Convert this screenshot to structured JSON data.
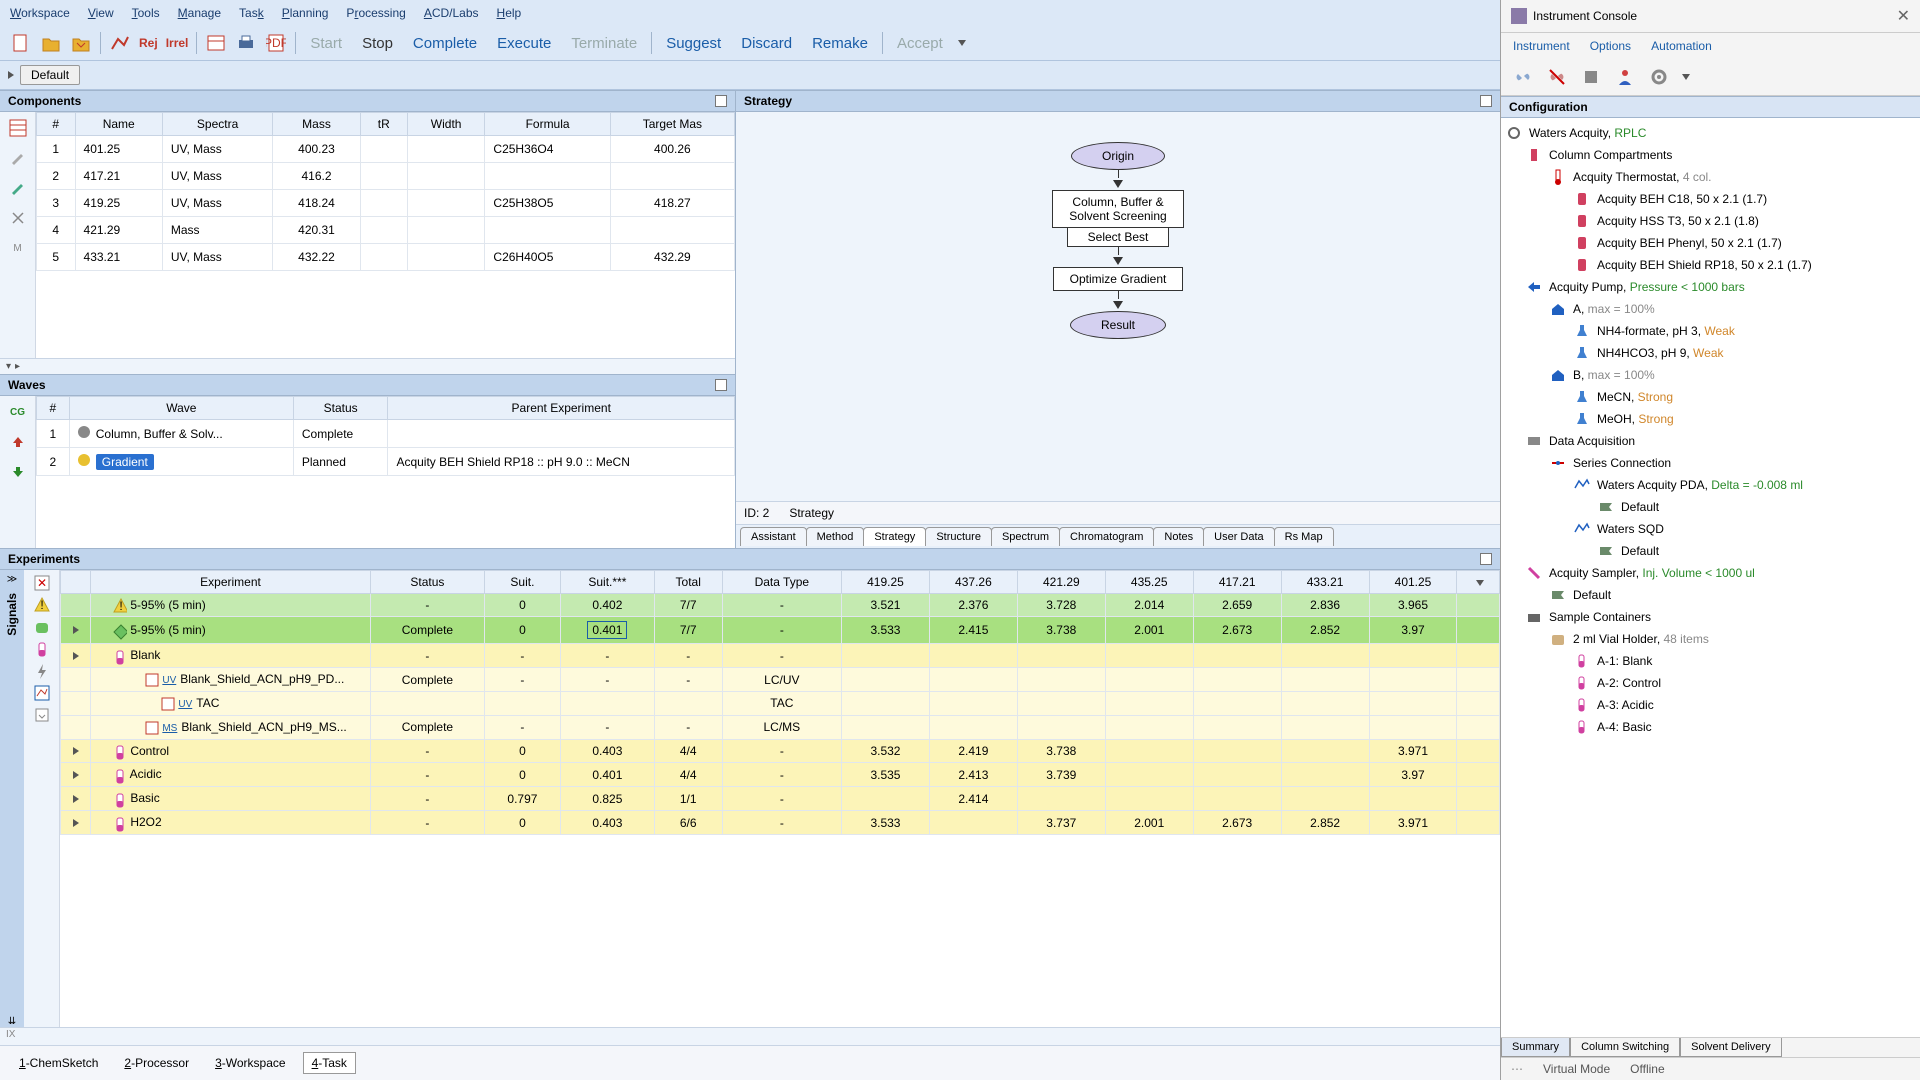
{
  "menu": [
    "Workspace",
    "View",
    "Tools",
    "Manage",
    "Task",
    "Planning",
    "Processing",
    "ACD/Labs",
    "Help"
  ],
  "toolbar_actions": {
    "start": "Start",
    "stop": "Stop",
    "complete": "Complete",
    "execute": "Execute",
    "terminate": "Terminate",
    "suggest": "Suggest",
    "discard": "Discard",
    "remake": "Remake",
    "accept": "Accept"
  },
  "default_label": "Default",
  "components": {
    "title": "Components",
    "headers": [
      "#",
      "Name",
      "Spectra",
      "Mass",
      "tR",
      "Width",
      "Formula",
      "Target Mas"
    ],
    "rows": [
      {
        "n": "1",
        "name": "401.25",
        "spectra": "UV, Mass",
        "mass": "400.23",
        "tR": "",
        "width": "",
        "formula": "C25H36O4",
        "target": "400.26"
      },
      {
        "n": "2",
        "name": "417.21",
        "spectra": "UV, Mass",
        "mass": "416.2",
        "tR": "",
        "width": "",
        "formula": "",
        "target": ""
      },
      {
        "n": "3",
        "name": "419.25",
        "spectra": "UV, Mass",
        "mass": "418.24",
        "tR": "",
        "width": "",
        "formula": "C25H38O5",
        "target": "418.27"
      },
      {
        "n": "4",
        "name": "421.29",
        "spectra": "Mass",
        "mass": "420.31",
        "tR": "",
        "width": "",
        "formula": "",
        "target": ""
      },
      {
        "n": "5",
        "name": "433.21",
        "spectra": "UV, Mass",
        "mass": "432.22",
        "tR": "",
        "width": "",
        "formula": "C26H40O5",
        "target": "432.29"
      }
    ]
  },
  "waves": {
    "title": "Waves",
    "headers": [
      "#",
      "Wave",
      "Status",
      "Parent Experiment"
    ],
    "rows": [
      {
        "n": "1",
        "wave": "Column, Buffer & Solv...",
        "status": "Complete",
        "parent": "",
        "badge": false,
        "dot": "#888"
      },
      {
        "n": "2",
        "wave": "Gradient",
        "status": "Planned",
        "parent": "Acquity BEH Shield RP18  ::  pH 9.0  ::  MeCN",
        "badge": true,
        "dot": "#e8c030"
      }
    ]
  },
  "strategy": {
    "title": "Strategy",
    "nodes": {
      "origin": "Origin",
      "screening": "Column, Buffer &\nSolvent Screening",
      "select": "Select Best",
      "optimize": "Optimize Gradient",
      "result": "Result"
    },
    "footer": {
      "id": "ID: 2",
      "label": "Strategy"
    },
    "tabs": [
      "Assistant",
      "Method",
      "Strategy",
      "Structure",
      "Spectrum",
      "Chromatogram",
      "Notes",
      "User Data",
      "Rs Map"
    ]
  },
  "experiments": {
    "title": "Experiments",
    "headers": [
      "Experiment",
      "Status",
      "Suit.",
      "Suit.***",
      "Total",
      "Data Type",
      "419.25",
      "437.26",
      "421.29",
      "435.25",
      "417.21",
      "433.21",
      "401.25"
    ],
    "rows": [
      {
        "cls": "green",
        "exp": "5-95% (5 min)",
        "icon": "warn",
        "status": "-",
        "suit": "0",
        "suit3": "0.402",
        "total": "7/7",
        "dt": "-",
        "v": [
          "3.521",
          "2.376",
          "3.728",
          "2.014",
          "2.659",
          "2.836",
          "3.965"
        ]
      },
      {
        "cls": "green-sel",
        "exp": "5-95% (5 min)",
        "icon": "warn-diamond",
        "status": "Complete",
        "suit": "0",
        "suit3": "0.401",
        "suit3box": true,
        "total": "7/7",
        "dt": "-",
        "v": [
          "3.533",
          "2.415",
          "3.738",
          "2.001",
          "2.673",
          "2.852",
          "3.97"
        ]
      },
      {
        "cls": "yellow",
        "exp": "Blank",
        "icon": "vial",
        "status": "-",
        "suit": "-",
        "suit3": "-",
        "total": "-",
        "dt": "-",
        "v": [
          "",
          "",
          "",
          "",
          "",
          "",
          ""
        ]
      },
      {
        "cls": "lightyellow",
        "exp": "Blank_Shield_ACN_pH9_PD...",
        "icon": "uv-doc",
        "indent": 3,
        "prefix": "UV",
        "status": "Complete",
        "suit": "-",
        "suit3": "-",
        "total": "-",
        "dt": "LC/UV",
        "v": [
          "",
          "",
          "",
          "",
          "",
          "",
          ""
        ]
      },
      {
        "cls": "lightyellow",
        "exp": "TAC",
        "icon": "uv",
        "indent": 4,
        "prefix": "UV",
        "status": "",
        "suit": "",
        "suit3": "",
        "total": "",
        "dt": "TAC",
        "v": [
          "",
          "",
          "",
          "",
          "",
          "",
          ""
        ]
      },
      {
        "cls": "lightyellow",
        "exp": "Blank_Shield_ACN_pH9_MS...",
        "icon": "ms-doc",
        "indent": 3,
        "prefix": "MS",
        "status": "Complete",
        "suit": "-",
        "suit3": "-",
        "total": "-",
        "dt": "LC/MS",
        "v": [
          "",
          "",
          "",
          "",
          "",
          "",
          ""
        ]
      },
      {
        "cls": "yellow",
        "exp": "Control",
        "icon": "vial",
        "status": "-",
        "suit": "0",
        "suit3": "0.403",
        "total": "4/4",
        "dt": "-",
        "v": [
          "3.532",
          "2.419",
          "3.738",
          "",
          "",
          "",
          "3.971"
        ]
      },
      {
        "cls": "yellow",
        "exp": "Acidic",
        "icon": "vial",
        "status": "-",
        "suit": "0",
        "suit3": "0.401",
        "total": "4/4",
        "dt": "-",
        "v": [
          "3.535",
          "2.413",
          "3.739",
          "",
          "",
          "",
          "3.97"
        ]
      },
      {
        "cls": "yellow",
        "exp": "Basic",
        "icon": "vial",
        "status": "-",
        "suit": "0.797",
        "suit3": "0.825",
        "total": "1/1",
        "dt": "-",
        "v": [
          "",
          "2.414",
          "",
          "",
          "",
          "",
          ""
        ]
      },
      {
        "cls": "yellow",
        "exp": "H2O2",
        "icon": "vial",
        "status": "-",
        "suit": "0",
        "suit3": "0.403",
        "total": "6/6",
        "dt": "-",
        "v": [
          "3.533",
          "",
          "3.737",
          "2.001",
          "2.673",
          "2.852",
          "3.971"
        ]
      }
    ]
  },
  "bottom_tabs": [
    "1-ChemSketch",
    "2-Processor",
    "3-Workspace",
    "4-Task"
  ],
  "console": {
    "title": "Instrument Console",
    "menu": [
      "Instrument",
      "Options",
      "Automation"
    ],
    "config_title": "Configuration",
    "tree": [
      {
        "lvl": 0,
        "icon": "gear",
        "txt": "Waters Acquity, ",
        "suffix": "RPLC",
        "sfxcls": "txt-green"
      },
      {
        "lvl": 1,
        "icon": "column",
        "txt": "Column Compartments"
      },
      {
        "lvl": 2,
        "icon": "thermo",
        "txt": "Acquity Thermostat, ",
        "suffix": "4 col.",
        "sfxcls": "txt-gray"
      },
      {
        "lvl": 3,
        "icon": "col-red",
        "txt": "Acquity BEH C18, 50 x 2.1 (1.7)"
      },
      {
        "lvl": 3,
        "icon": "col-red",
        "txt": "Acquity HSS T3, 50 x 2.1 (1.8)"
      },
      {
        "lvl": 3,
        "icon": "col-red",
        "txt": "Acquity BEH Phenyl, 50 x 2.1 (1.7)"
      },
      {
        "lvl": 3,
        "icon": "col-red",
        "txt": "Acquity BEH Shield RP18, 50 x 2.1 (1.7)"
      },
      {
        "lvl": 1,
        "icon": "pump",
        "txt": "Acquity Pump, ",
        "suffix": "Pressure < 1000 bars",
        "sfxcls": "txt-green"
      },
      {
        "lvl": 2,
        "icon": "home",
        "txt": "A,  ",
        "suffix": "max = 100%",
        "sfxcls": "txt-gray"
      },
      {
        "lvl": 3,
        "icon": "flask",
        "txt": "NH4-formate, pH 3, ",
        "suffix": "Weak",
        "sfxcls": "txt-orange"
      },
      {
        "lvl": 3,
        "icon": "flask",
        "txt": "NH4HCO3, pH 9, ",
        "suffix": "Weak",
        "sfxcls": "txt-orange"
      },
      {
        "lvl": 2,
        "icon": "home",
        "txt": "B,  ",
        "suffix": "max = 100%",
        "sfxcls": "txt-gray"
      },
      {
        "lvl": 3,
        "icon": "flask",
        "txt": "MeCN, ",
        "suffix": "Strong",
        "sfxcls": "txt-orange"
      },
      {
        "lvl": 3,
        "icon": "flask",
        "txt": "MeOH, ",
        "suffix": "Strong",
        "sfxcls": "txt-orange"
      },
      {
        "lvl": 1,
        "icon": "daq",
        "txt": "Data Acquisition"
      },
      {
        "lvl": 2,
        "icon": "series",
        "txt": "Series Connection"
      },
      {
        "lvl": 3,
        "icon": "pda",
        "txt": "Waters Acquity PDA, ",
        "suffix": "Delta = -0.008 ml",
        "sfxcls": "txt-green"
      },
      {
        "lvl": 4,
        "icon": "default",
        "txt": "Default"
      },
      {
        "lvl": 3,
        "icon": "pda",
        "txt": "Waters SQD"
      },
      {
        "lvl": 4,
        "icon": "default",
        "txt": "Default"
      },
      {
        "lvl": 1,
        "icon": "sampler",
        "txt": "Acquity Sampler, ",
        "suffix": "Inj. Volume < 1000 ul",
        "sfxcls": "txt-green"
      },
      {
        "lvl": 2,
        "icon": "default",
        "txt": "Default"
      },
      {
        "lvl": 1,
        "icon": "container",
        "txt": "Sample Containers"
      },
      {
        "lvl": 2,
        "icon": "holder",
        "txt": "2 ml Vial Holder, ",
        "suffix": "48 items",
        "sfxcls": "txt-gray"
      },
      {
        "lvl": 3,
        "icon": "vial-t",
        "txt": "A-1: Blank"
      },
      {
        "lvl": 3,
        "icon": "vial-t",
        "txt": "A-2: Control"
      },
      {
        "lvl": 3,
        "icon": "vial-t",
        "txt": "A-3: Acidic"
      },
      {
        "lvl": 3,
        "icon": "vial-t",
        "txt": "A-4: Basic"
      }
    ],
    "tabs": [
      "Summary",
      "Column Switching",
      "Solvent Delivery"
    ],
    "status": [
      "Virtual Mode",
      "Offline"
    ]
  }
}
